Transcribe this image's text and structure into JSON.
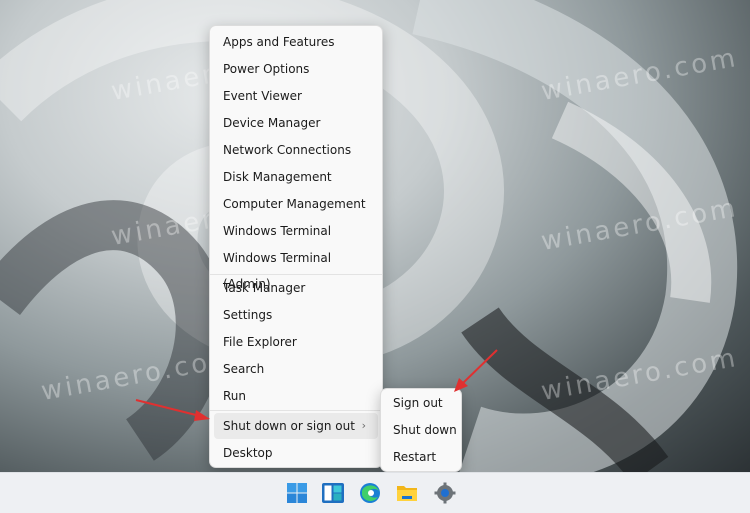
{
  "context_menu": {
    "groups": [
      [
        "Apps and Features",
        "Power Options",
        "Event Viewer",
        "Device Manager",
        "Network Connections",
        "Disk Management",
        "Computer Management",
        "Windows Terminal",
        "Windows Terminal (Admin)"
      ],
      [
        "Task Manager",
        "Settings",
        "File Explorer",
        "Search",
        "Run",
        "Shut down or sign out",
        "Desktop"
      ]
    ],
    "items": {
      "apps_features": "Apps and Features",
      "power_options": "Power Options",
      "event_viewer": "Event Viewer",
      "device_manager": "Device Manager",
      "network_connections": "Network Connections",
      "disk_management": "Disk Management",
      "computer_management": "Computer Management",
      "windows_terminal": "Windows Terminal",
      "windows_terminal_admin": "Windows Terminal (Admin)",
      "task_manager": "Task Manager",
      "settings": "Settings",
      "file_explorer": "File Explorer",
      "search": "Search",
      "run": "Run",
      "shut_down_or_sign_out": "Shut down or sign out",
      "desktop": "Desktop"
    },
    "highlighted": "Shut down or sign out",
    "submenu_chevron": "›"
  },
  "submenu": {
    "items": [
      "Sign out",
      "Shut down",
      "Restart"
    ],
    "sign_out": "Sign out",
    "shut_down": "Shut down",
    "restart": "Restart"
  },
  "taskbar": {
    "icons": [
      "windows-start-icon",
      "widgets-icon",
      "edge-icon",
      "file-explorer-icon",
      "settings-icon"
    ]
  },
  "watermark": "winaero.com",
  "colors": {
    "annotation_arrow": "#e03030",
    "menu_bg": "#f9f9f9",
    "highlight_bg": "#eaeaea"
  }
}
